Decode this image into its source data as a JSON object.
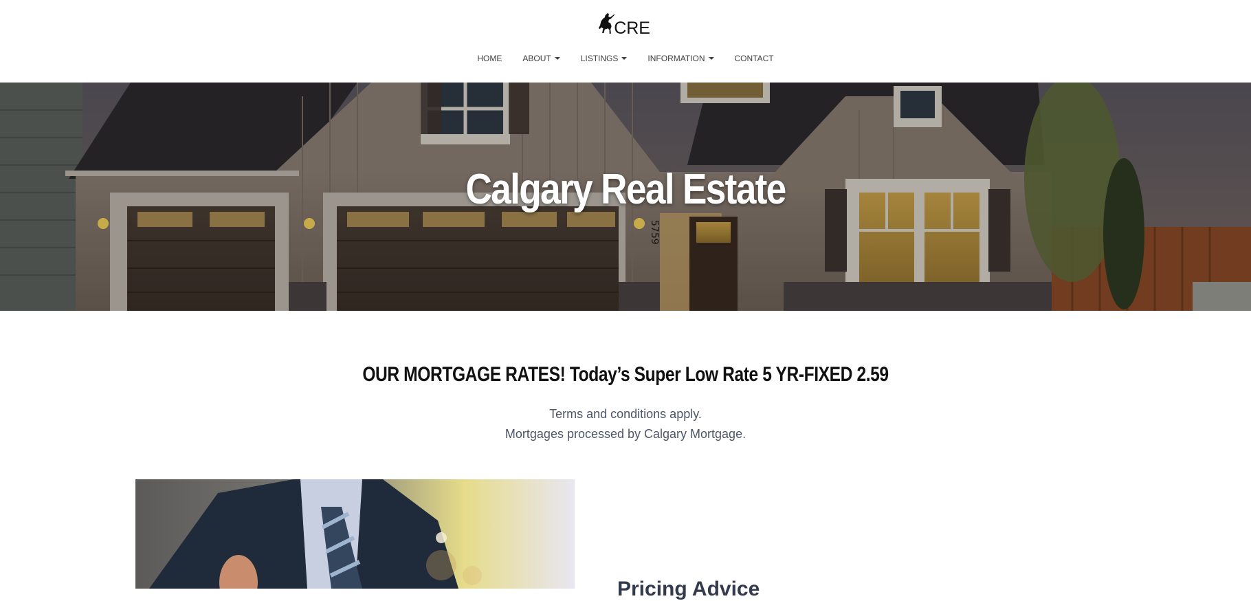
{
  "header": {
    "logo_text": "CRE",
    "nav": [
      {
        "label": "HOME",
        "dropdown": false
      },
      {
        "label": "ABOUT",
        "dropdown": true
      },
      {
        "label": "LISTINGS",
        "dropdown": true
      },
      {
        "label": "INFORMATION",
        "dropdown": true
      },
      {
        "label": "CONTACT",
        "dropdown": false
      }
    ]
  },
  "hero": {
    "title": "Calgary Real Estate",
    "house_number": "5759"
  },
  "mortgage": {
    "heading": "OUR MORTGAGE RATES! Today’s Super Low Rate 5 YR-FIXED 2.59",
    "line1": "Terms and conditions apply.",
    "line2": "Mortgages processed by Calgary Mortgage."
  },
  "content": {
    "advice_heading": "Pricing Advice"
  },
  "colors": {
    "nav_text": "#404040",
    "body_text": "#4d5566",
    "heading_text": "#111111",
    "hero_title": "#ffffff"
  }
}
